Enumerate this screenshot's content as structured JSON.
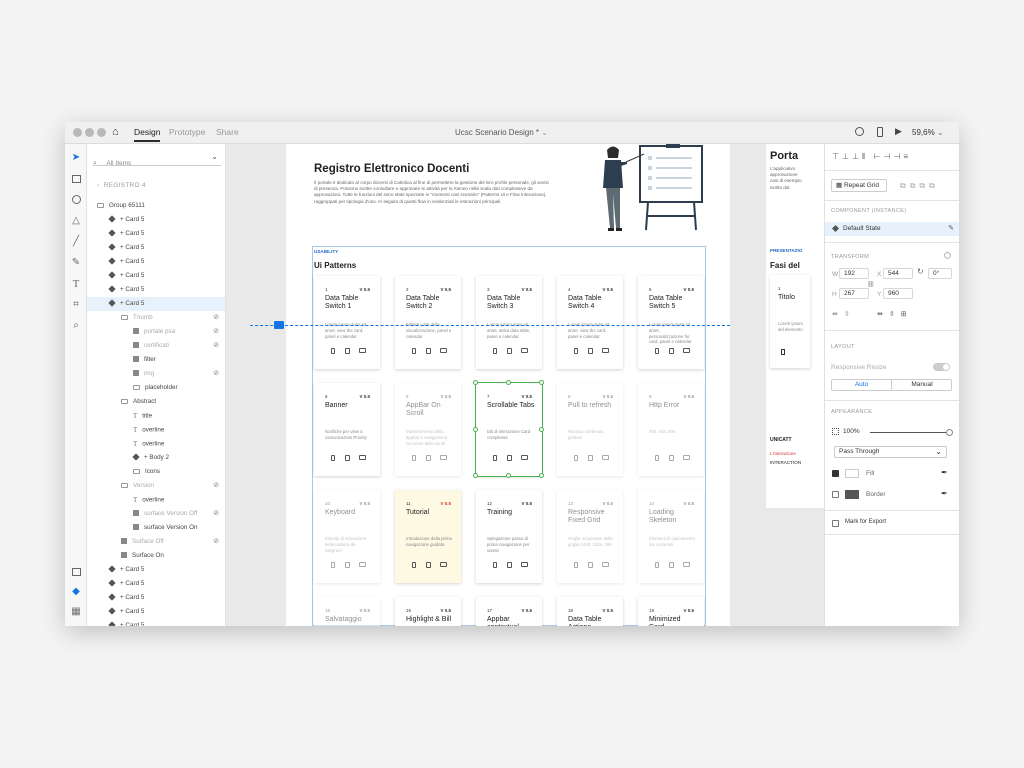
{
  "window": {
    "tabs": [
      "Design",
      "Prototype",
      "Share"
    ],
    "doc_title": "Ucsc Scenario Design *",
    "zoom": "59,6%"
  },
  "layers": {
    "search_placeholder": "All Items",
    "breadcrumb": "REGISTRO 4",
    "rows": [
      {
        "label": "Group 65111",
        "icon": "grp",
        "indent": 0
      },
      {
        "label": "+ Card 5",
        "icon": "comp",
        "indent": 1
      },
      {
        "label": "+ Card 5",
        "icon": "comp",
        "indent": 1
      },
      {
        "label": "+ Card 5",
        "icon": "comp",
        "indent": 1
      },
      {
        "label": "+ Card 5",
        "icon": "comp",
        "indent": 1
      },
      {
        "label": "+ Card 5",
        "icon": "comp",
        "indent": 1
      },
      {
        "label": "+ Card 5",
        "icon": "comp",
        "indent": 1
      },
      {
        "label": "+ Card 5",
        "icon": "comp",
        "indent": 1,
        "selected": true
      },
      {
        "label": "Tnumb",
        "icon": "grp",
        "indent": 2,
        "dim": true,
        "hidden": true
      },
      {
        "label": "portale psa",
        "icon": "rect",
        "indent": 3,
        "dim": true,
        "hidden": true
      },
      {
        "label": "certificati",
        "icon": "rect",
        "indent": 3,
        "dim": true,
        "hidden": true
      },
      {
        "label": "filter",
        "icon": "rect",
        "indent": 3
      },
      {
        "label": "img",
        "icon": "rect",
        "indent": 3,
        "dim": true,
        "hidden": true
      },
      {
        "label": "placeholder",
        "icon": "grp",
        "indent": 3
      },
      {
        "label": "Abstract",
        "icon": "grp",
        "indent": 2
      },
      {
        "label": "title",
        "icon": "txt",
        "indent": 3
      },
      {
        "label": "overline",
        "icon": "txt",
        "indent": 3
      },
      {
        "label": "overline",
        "icon": "txt",
        "indent": 3
      },
      {
        "label": "+ Body 2",
        "icon": "comp",
        "indent": 3
      },
      {
        "label": "Icons",
        "icon": "grp",
        "indent": 3
      },
      {
        "label": "Version",
        "icon": "grp",
        "indent": 2,
        "dim": true,
        "hidden": true
      },
      {
        "label": "overline",
        "icon": "txt",
        "indent": 3
      },
      {
        "label": "surface Version Off",
        "icon": "rect",
        "indent": 3,
        "dim": true,
        "hidden": true
      },
      {
        "label": "surface Version On",
        "icon": "rect",
        "indent": 3
      },
      {
        "label": "Surface Off",
        "icon": "rect",
        "indent": 2,
        "dim": true,
        "hidden": true
      },
      {
        "label": "Surface On",
        "icon": "rect",
        "indent": 2
      },
      {
        "label": "+ Card 5",
        "icon": "comp",
        "indent": 1
      },
      {
        "label": "+ Card 5",
        "icon": "comp",
        "indent": 1
      },
      {
        "label": "+ Card 5",
        "icon": "comp",
        "indent": 1
      },
      {
        "label": "+ Card 5",
        "icon": "comp",
        "indent": 1
      },
      {
        "label": "+ Card 5",
        "icon": "comp",
        "indent": 1
      }
    ]
  },
  "artboard": {
    "title": "Registro Elettronico Docenti",
    "intro": "Il portale è dedicato al corpo docenti di Cattolica al fine di permettere la gestione del loro profilo personale, gli avvisi di presenza. Possono inoltre consultare e approvare le attività per lo Ateneo nella scala dati complessive da approvazioni. Tutte le funzioni del sono state spezzate in \"momenti casi scenario\" (Patterns Ui e Flow Interazione), raggruppati per tipologia d'uso. In seguito di questi flow in evidenziati le interazioni principali",
    "usability_label": "USABILITY",
    "section_title": "Ui Patterns",
    "cards": [
      {
        "num": "1",
        "ver": "V 0.5",
        "title": "Data Table Switch 1",
        "desc": "Lorem ipsum dolor sit amet, view the card, panel e calendar",
        "state": "normal"
      },
      {
        "num": "2",
        "ver": "V 0.5",
        "title": "Data Table Switch 2",
        "desc": "Filtrate i dati della visualizzazione, panel e calendar",
        "state": "normal"
      },
      {
        "num": "3",
        "ver": "V 0.5",
        "title": "Data Table Switch 3",
        "desc": "Lorem ipsum dolor sit amet, attiva data table, panel e calendar",
        "state": "normal"
      },
      {
        "num": "4",
        "ver": "V 0.5",
        "title": "Data Table Switch 4",
        "desc": "Lorem ipsum dolor sit amet, view the card, panel e calendar",
        "state": "normal"
      },
      {
        "num": "5",
        "ver": "V 0.5",
        "title": "Data Table Switch 5",
        "desc": "Lorem ipsum dolor sit amet, personalizzazione for card, panel e calendar",
        "state": "normal"
      },
      {
        "num": "6",
        "ver": "V 0.5",
        "title": "Banner",
        "desc": "Notifiche per view a comunicazioni Priority",
        "state": "normal"
      },
      {
        "num": "6",
        "ver": "V 0.5",
        "title": "AppBar On Scroll",
        "desc": "Mantenimento della appbar e navigazione nel corso dello scroll",
        "state": "faded"
      },
      {
        "num": "7",
        "ver": "V 0.5",
        "title": "Scrollable Tabs",
        "desc": "tab di interazione Card complessa",
        "state": "selected"
      },
      {
        "num": "8",
        "ver": "V 0.5",
        "title": "Pull to refresh",
        "desc": "Ricarica contenuto gesture",
        "state": "faded"
      },
      {
        "num": "9",
        "ver": "V 0.5",
        "title": "Http Error",
        "desc": "400, 404, 500",
        "state": "faded"
      },
      {
        "num": "10",
        "ver": "V 0.5",
        "title": "Keyboard",
        "desc": "Esempi di interazione della tastiera da integrare",
        "state": "faded"
      },
      {
        "num": "11",
        "ver": "V 0.5",
        "title": "Tutorial",
        "desc": "Introduzione della prima navigazione guidata",
        "state": "yellow"
      },
      {
        "num": "12",
        "ver": "V 0.5",
        "title": "Training",
        "desc": "Spiegazione passo di prima navigazione per utente",
        "state": "normal"
      },
      {
        "num": "13",
        "ver": "V 0.5",
        "title": "Responsive Fixed Grid",
        "desc": "Griglia responsive della griglia 1440, 1024, 360",
        "state": "faded"
      },
      {
        "num": "14",
        "ver": "V 0.5",
        "title": "Loading Skeleton",
        "desc": "Elementi di caricamento dei contenuti",
        "state": "faded"
      },
      {
        "num": "15",
        "ver": "V 0.5",
        "title": "Salvataggio",
        "desc": "",
        "state": "faded"
      },
      {
        "num": "16",
        "ver": "V 0.5",
        "title": "Highlight & Bill",
        "desc": "",
        "state": "normal"
      },
      {
        "num": "17",
        "ver": "V 0.5",
        "title": "Appbar contextual",
        "desc": "",
        "state": "normal"
      },
      {
        "num": "18",
        "ver": "V 0.5",
        "title": "Data Table Actions",
        "desc": "",
        "state": "normal"
      },
      {
        "num": "19",
        "ver": "V 0.5",
        "title": "Minimized Card",
        "desc": "",
        "state": "normal"
      }
    ]
  },
  "artboard2": {
    "title": "Porta",
    "text": "L'applicativo approvazione casi di esempio svolto dal",
    "present_label": "PRESENTAZIO",
    "section_title": "Fasi del",
    "card_num": "1",
    "card_title": "Titolo",
    "card_desc": "Lorem ipsum del elemento",
    "unicatt_label": "UNICATT",
    "red_text": "L'interazione",
    "interaction_label": "INTERACTION"
  },
  "inspector": {
    "repeat_grid": "Repeat Grid",
    "component_label": "COMPONENT (INSTANCE)",
    "state": "Default State",
    "transform_label": "TRANSFORM",
    "w": "192",
    "x": "544",
    "rotation": "0°",
    "h": "267",
    "y": "960",
    "layout_label": "LAYOUT",
    "responsive_resize": "Responsive Resize",
    "auto": "Auto",
    "manual": "Manual",
    "appearance_label": "APPEARANCE",
    "opacity": "100%",
    "blend": "Pass Through",
    "fill": "Fill",
    "border": "Border",
    "export": "Mark for Export"
  },
  "colors": {
    "accent": "#1473e6",
    "selection": "#4caf50",
    "tutorial_bg": "#fdf9e2"
  }
}
